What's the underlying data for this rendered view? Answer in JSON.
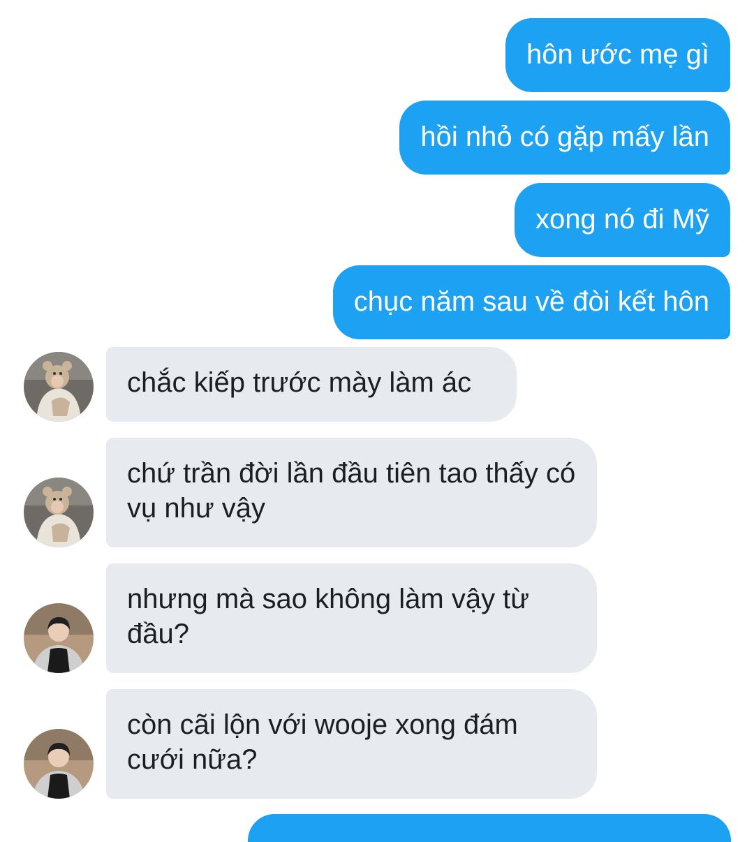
{
  "messages": [
    {
      "side": "sent",
      "text": "hôn ước mẹ gì"
    },
    {
      "side": "sent",
      "text": "hồi nhỏ có gặp mấy lần"
    },
    {
      "side": "sent",
      "text": "xong nó đi Mỹ"
    },
    {
      "side": "sent",
      "text": "chục năm sau về đòi kết hôn"
    },
    {
      "side": "received",
      "avatar": "avatar-bear-hat",
      "text": "chắc kiếp trước mày làm ác"
    },
    {
      "side": "received",
      "avatar": "avatar-bear-hat",
      "text": "chứ trần đời lần đầu tiên tao thấy có vụ như vậy"
    },
    {
      "side": "received",
      "avatar": "avatar-boy",
      "text": "nhưng mà sao không làm vậy từ đầu?"
    },
    {
      "side": "received",
      "avatar": "avatar-boy",
      "text": "còn cãi lộn với wooje xong đám cưới nữa?"
    }
  ],
  "colors": {
    "sent_bubble": "#1da1f2",
    "received_bubble": "#e7eaee",
    "received_text": "#1c1e21"
  }
}
